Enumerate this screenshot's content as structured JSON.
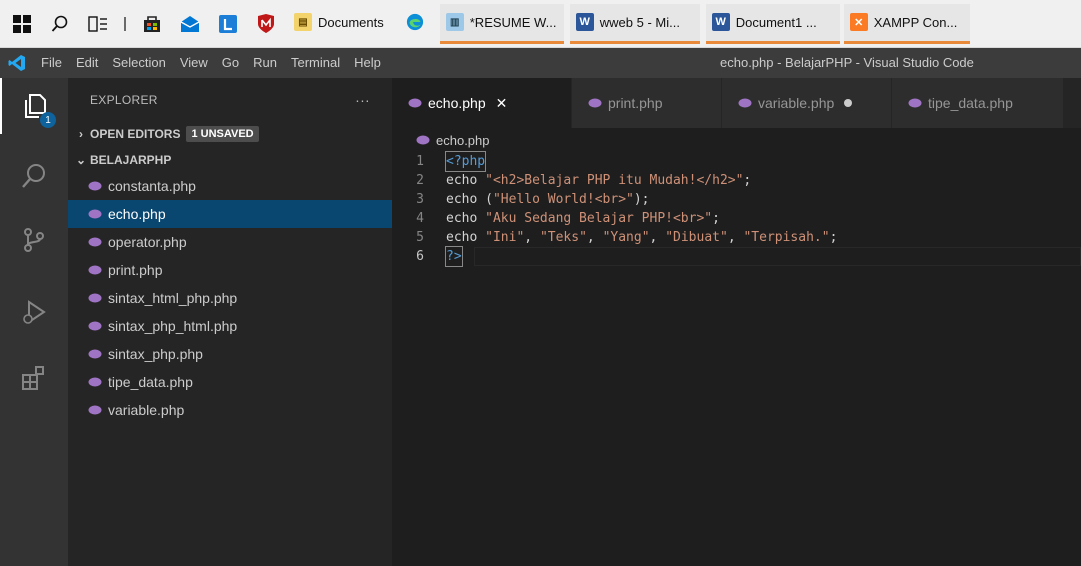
{
  "taskbar": {
    "apps": [
      {
        "label": "Documents",
        "active": false
      },
      {
        "label": "",
        "active": false
      },
      {
        "label": "*RESUME W...",
        "active": true
      },
      {
        "label": "wweb 5 - Mi...",
        "active": true
      },
      {
        "label": "Document1 ...",
        "active": true
      },
      {
        "label": "XAMPP Con...",
        "active": true
      }
    ]
  },
  "menubar": {
    "items": [
      "File",
      "Edit",
      "Selection",
      "View",
      "Go",
      "Run",
      "Terminal",
      "Help"
    ],
    "window_title": "echo.php - BelajarPHP - Visual Studio Code"
  },
  "activity": {
    "explorer_badge": "1"
  },
  "sidebar": {
    "title": "EXPLORER",
    "more": "···",
    "open_editors": {
      "label": "OPEN EDITORS",
      "badge": "1 UNSAVED"
    },
    "folder": "BELAJARPHP",
    "files": [
      "constanta.php",
      "echo.php",
      "operator.php",
      "print.php",
      "sintax_html_php.php",
      "sintax_php_html.php",
      "sintax_php.php",
      "tipe_data.php",
      "variable.php"
    ],
    "selected_file": "echo.php"
  },
  "editor": {
    "tabs": [
      {
        "label": "echo.php",
        "active": true,
        "close": "✕"
      },
      {
        "label": "print.php",
        "active": false
      },
      {
        "label": "variable.php",
        "active": false,
        "unsaved": true
      },
      {
        "label": "tipe_data.php",
        "active": false
      }
    ],
    "breadcrumb": "echo.php",
    "lines": [
      {
        "n": "1",
        "parts": [
          {
            "t": "<?php",
            "c": "kw"
          }
        ]
      },
      {
        "n": "2",
        "parts": [
          {
            "t": "echo ",
            "c": "txt"
          },
          {
            "t": "\"<h2>Belajar PHP itu Mudah!</h2>\"",
            "c": "str"
          },
          {
            "t": ";",
            "c": "txt"
          }
        ]
      },
      {
        "n": "3",
        "parts": [
          {
            "t": "echo (",
            "c": "txt"
          },
          {
            "t": "\"Hello World!<br>\"",
            "c": "str"
          },
          {
            "t": ");",
            "c": "txt"
          }
        ]
      },
      {
        "n": "4",
        "parts": [
          {
            "t": "echo ",
            "c": "txt"
          },
          {
            "t": "\"Aku Sedang Belajar PHP!<br>\"",
            "c": "str"
          },
          {
            "t": ";",
            "c": "txt"
          }
        ]
      },
      {
        "n": "5",
        "parts": [
          {
            "t": "echo ",
            "c": "txt"
          },
          {
            "t": "\"Ini\"",
            "c": "str"
          },
          {
            "t": ", ",
            "c": "txt"
          },
          {
            "t": "\"Teks\"",
            "c": "str"
          },
          {
            "t": ", ",
            "c": "txt"
          },
          {
            "t": "\"Yang\"",
            "c": "str"
          },
          {
            "t": ", ",
            "c": "txt"
          },
          {
            "t": "\"Dibuat\"",
            "c": "str"
          },
          {
            "t": ", ",
            "c": "txt"
          },
          {
            "t": "\"Terpisah.\"",
            "c": "str"
          },
          {
            "t": ";",
            "c": "txt"
          }
        ]
      },
      {
        "n": "6",
        "parts": [
          {
            "t": "?>",
            "c": "kw"
          }
        ]
      }
    ]
  },
  "colors": {
    "accent": "#0e639c",
    "selection": "#094771",
    "php_icon": "#a074c4"
  }
}
